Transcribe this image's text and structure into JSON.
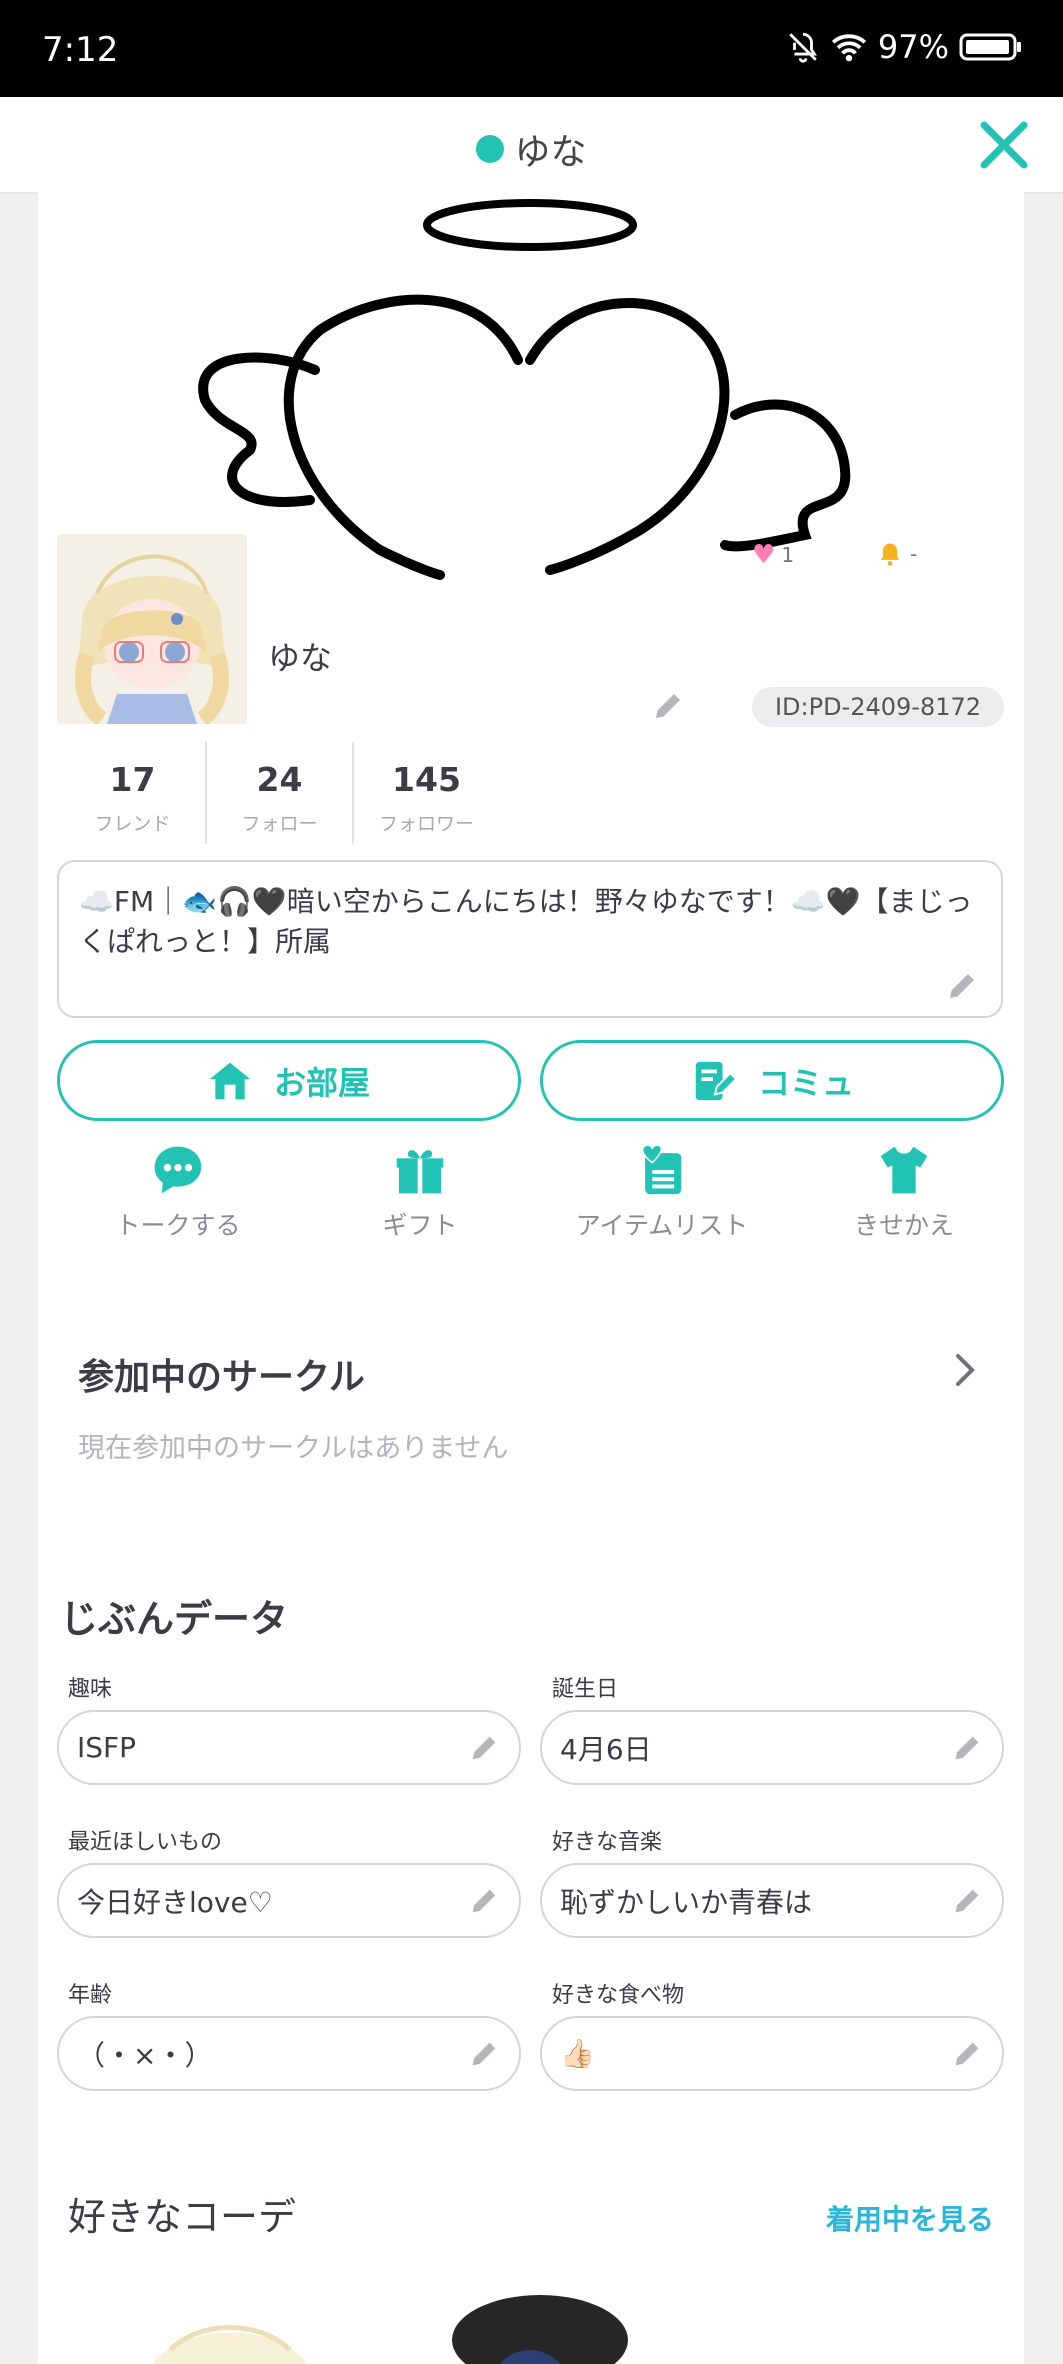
{
  "status_bar": {
    "time": "7:12",
    "battery": "97%"
  },
  "header": {
    "title": "ゆな"
  },
  "banner": {
    "likes": "1",
    "bell": "-"
  },
  "profile": {
    "name": "ゆな",
    "id": "ID:PD-2409-8172",
    "counts": [
      {
        "value": "17",
        "label": "フレンド"
      },
      {
        "value": "24",
        "label": "フォロー"
      },
      {
        "value": "145",
        "label": "フォロワー"
      }
    ],
    "bio": "☁️FM｜🐟🎧🖤暗い空からこんにちは！野々ゆなです！☁️🖤【まじっくぱれっと！】所属"
  },
  "buttons": {
    "room": "お部屋",
    "commu": "コミュ"
  },
  "actions": [
    {
      "label": "トークする",
      "icon": "chat-icon"
    },
    {
      "label": "ギフト",
      "icon": "gift-icon"
    },
    {
      "label": "アイテムリスト",
      "icon": "item-list-icon"
    },
    {
      "label": "きせかえ",
      "icon": "shirt-icon"
    }
  ],
  "circles": {
    "title": "参加中のサークル",
    "empty": "現在参加中のサークルはありません"
  },
  "data_section": {
    "title": "じぶんデータ",
    "fields": [
      {
        "label": "趣味",
        "value": "ISFP"
      },
      {
        "label": "誕生日",
        "value": "4月6日"
      },
      {
        "label": "最近ほしいもの",
        "value": "今日好きlove♡"
      },
      {
        "label": "好きな音楽",
        "value": "恥ずかしいか青春は"
      },
      {
        "label": "年齢",
        "value": "（・×・）"
      },
      {
        "label": "好きな食べ物",
        "value": "👍🏻"
      }
    ]
  },
  "coords": {
    "title": "好きなコーデ",
    "link": "着用中を見る"
  },
  "colors": {
    "accent": "#22c2b4",
    "link": "#29b6d8"
  }
}
